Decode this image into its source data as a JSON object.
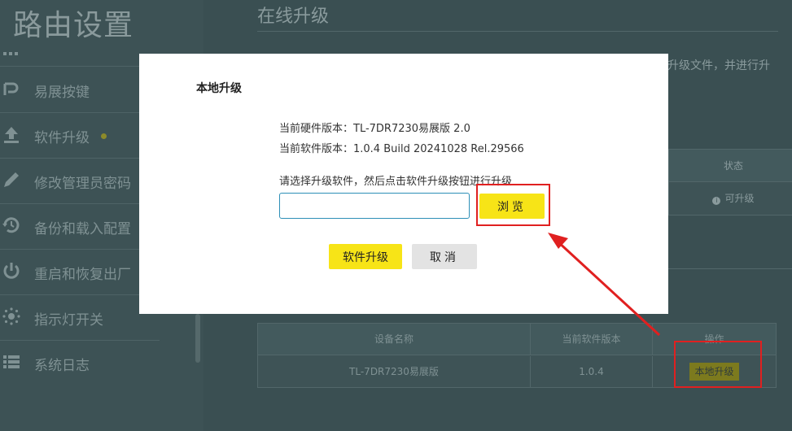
{
  "sidebar": {
    "title": "路由设置",
    "items": [
      {
        "label": "",
        "icon": "grid-icon"
      },
      {
        "label": "易展按键",
        "icon": "wps-key-icon"
      },
      {
        "label": "软件升级",
        "icon": "upgrade-icon",
        "dot": true
      },
      {
        "label": "修改管理员密码",
        "icon": "pencil-icon"
      },
      {
        "label": "备份和载入配置",
        "icon": "backup-restore-icon"
      },
      {
        "label": "重启和恢复出厂",
        "icon": "power-icon"
      },
      {
        "label": "指示灯开关",
        "icon": "led-icon"
      },
      {
        "label": "系统日志",
        "icon": "list-icon"
      }
    ]
  },
  "main": {
    "title": "在线升级",
    "desc": "升级文件，并进行升",
    "status_table": {
      "header": "状态",
      "value": "可升级"
    },
    "device_table": {
      "headers": [
        "设备名称",
        "当前软件版本",
        "操作"
      ],
      "row": {
        "device": "TL-7DR7230易展版",
        "version": "1.0.4",
        "action": "本地升级"
      }
    }
  },
  "modal": {
    "title": "本地升级",
    "hw_line": "当前硬件版本：TL-7DR7230易展版 2.0",
    "sw_line": "当前软件版本：1.0.4 Build 20241028 Rel.29566",
    "hint": "请选择升级软件，然后点击软件升级按钮进行升级",
    "file_value": "",
    "browse_label": "浏览",
    "upgrade_label": "软件升级",
    "cancel_label": "取消"
  },
  "colors": {
    "accent": "#f7e417",
    "annotation": "#e02020",
    "input_border": "#2d8fb7"
  }
}
